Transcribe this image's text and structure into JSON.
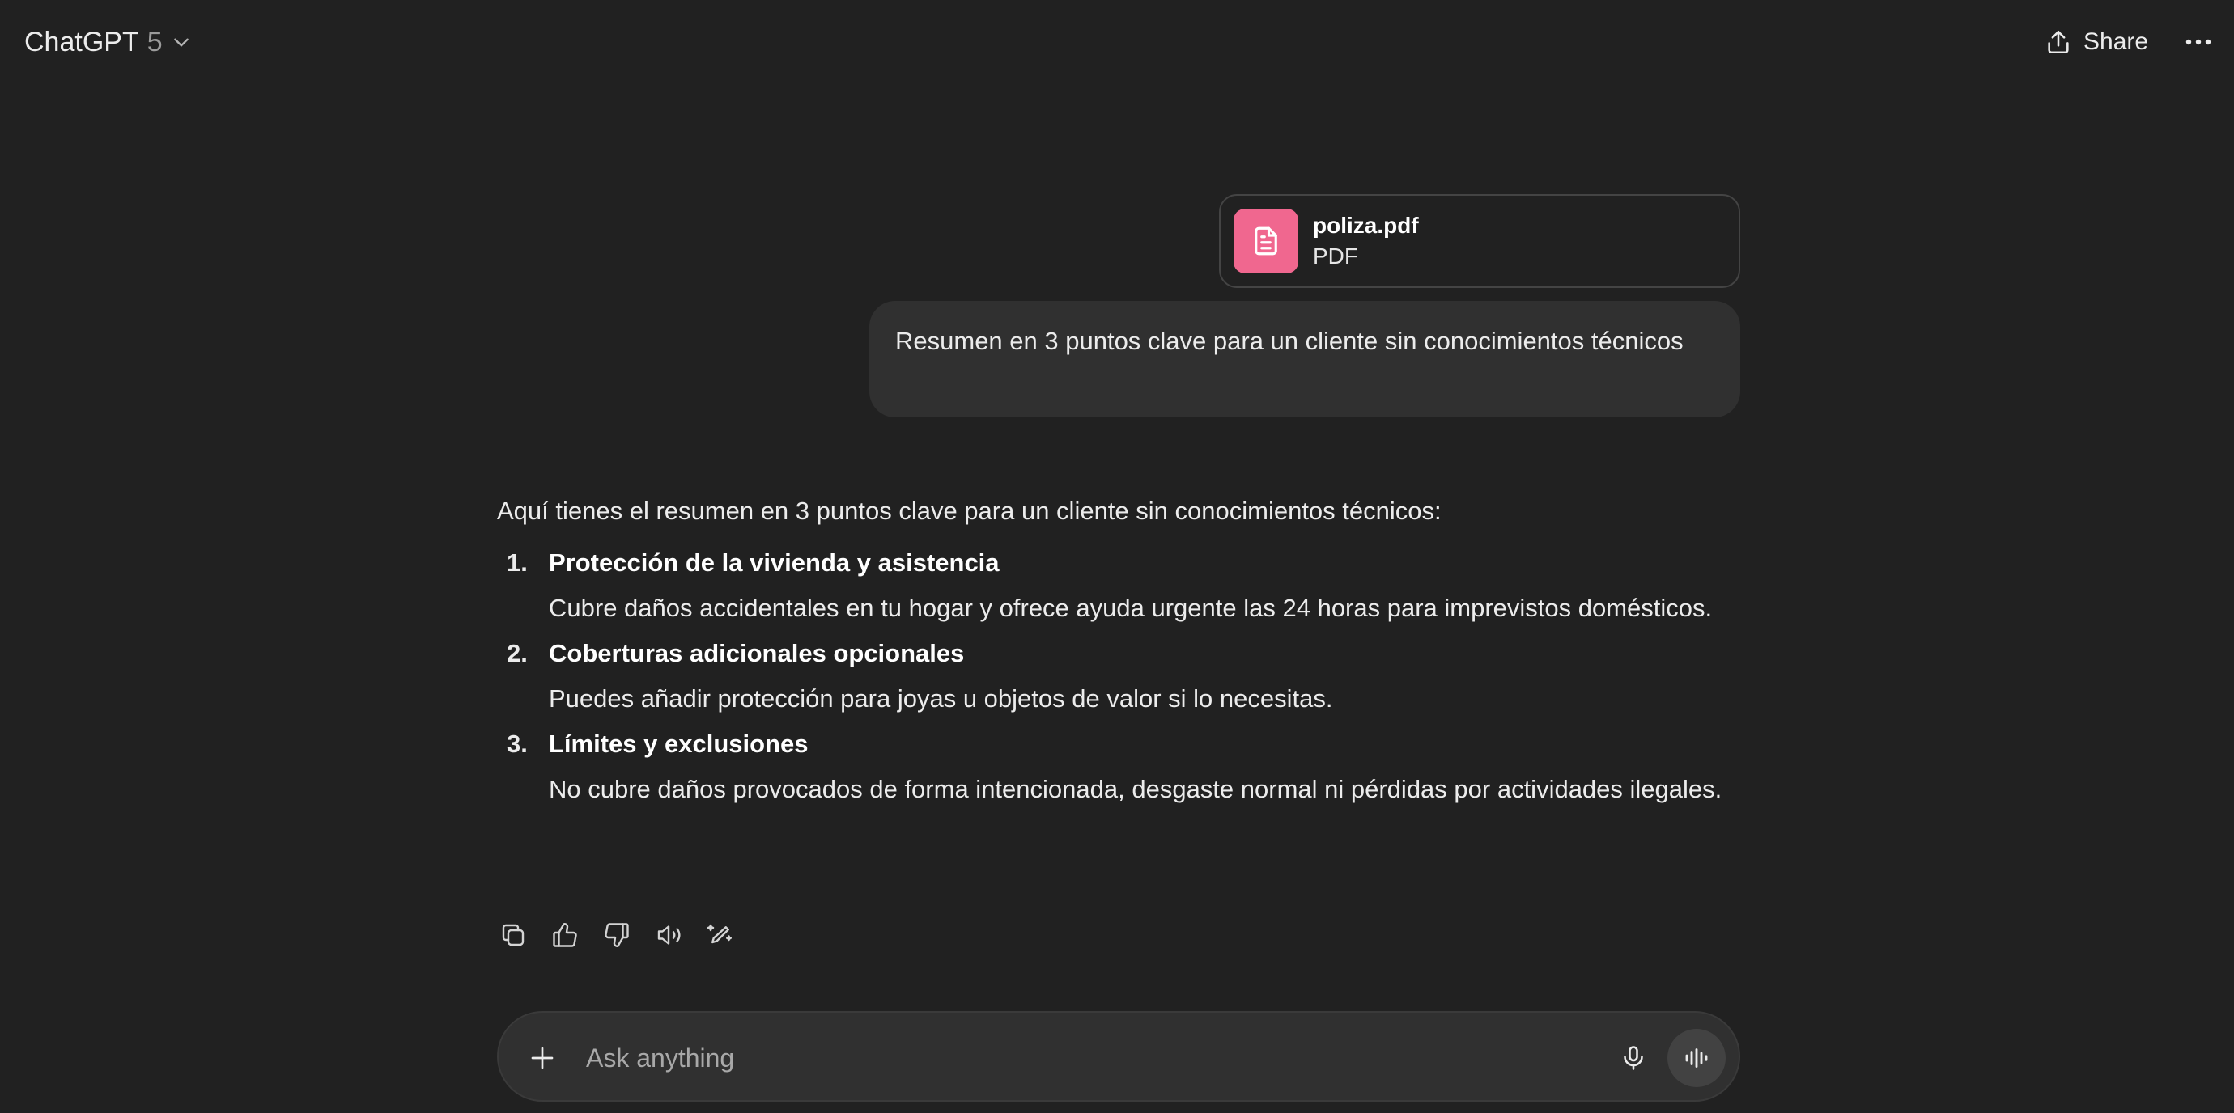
{
  "header": {
    "model_name": "ChatGPT",
    "model_version": "5",
    "share_label": "Share"
  },
  "attachment": {
    "name": "poliza.pdf",
    "type": "PDF",
    "icon": "document-icon",
    "color": "#f0678f"
  },
  "user_message": {
    "text": "Resumen en 3 puntos clave para un cliente sin conocimientos técnicos"
  },
  "assistant_message": {
    "intro": "Aquí tienes el resumen en 3 puntos clave para un cliente sin conocimientos técnicos:",
    "points": [
      {
        "number": "1.",
        "title": "Protección de la vivienda y asistencia",
        "description": "Cubre daños accidentales en tu hogar y ofrece ayuda urgente las 24 horas para imprevistos domésticos."
      },
      {
        "number": "2.",
        "title": "Coberturas adicionales opcionales",
        "description": "Puedes añadir protección para joyas u objetos de valor si lo necesitas."
      },
      {
        "number": "3.",
        "title": "Límites y exclusiones",
        "description": "No cubre daños provocados de forma intencionada, desgaste normal ni pérdidas por actividades ilegales."
      }
    ]
  },
  "message_actions": [
    "copy-icon",
    "thumbs-up-icon",
    "thumbs-down-icon",
    "read-aloud-icon",
    "edit-in-canvas-icon"
  ],
  "composer": {
    "placeholder": "Ask anything"
  },
  "colors": {
    "background": "#212121",
    "bubble": "#303030",
    "text": "#ececec",
    "attachment_accent": "#f0678f"
  }
}
